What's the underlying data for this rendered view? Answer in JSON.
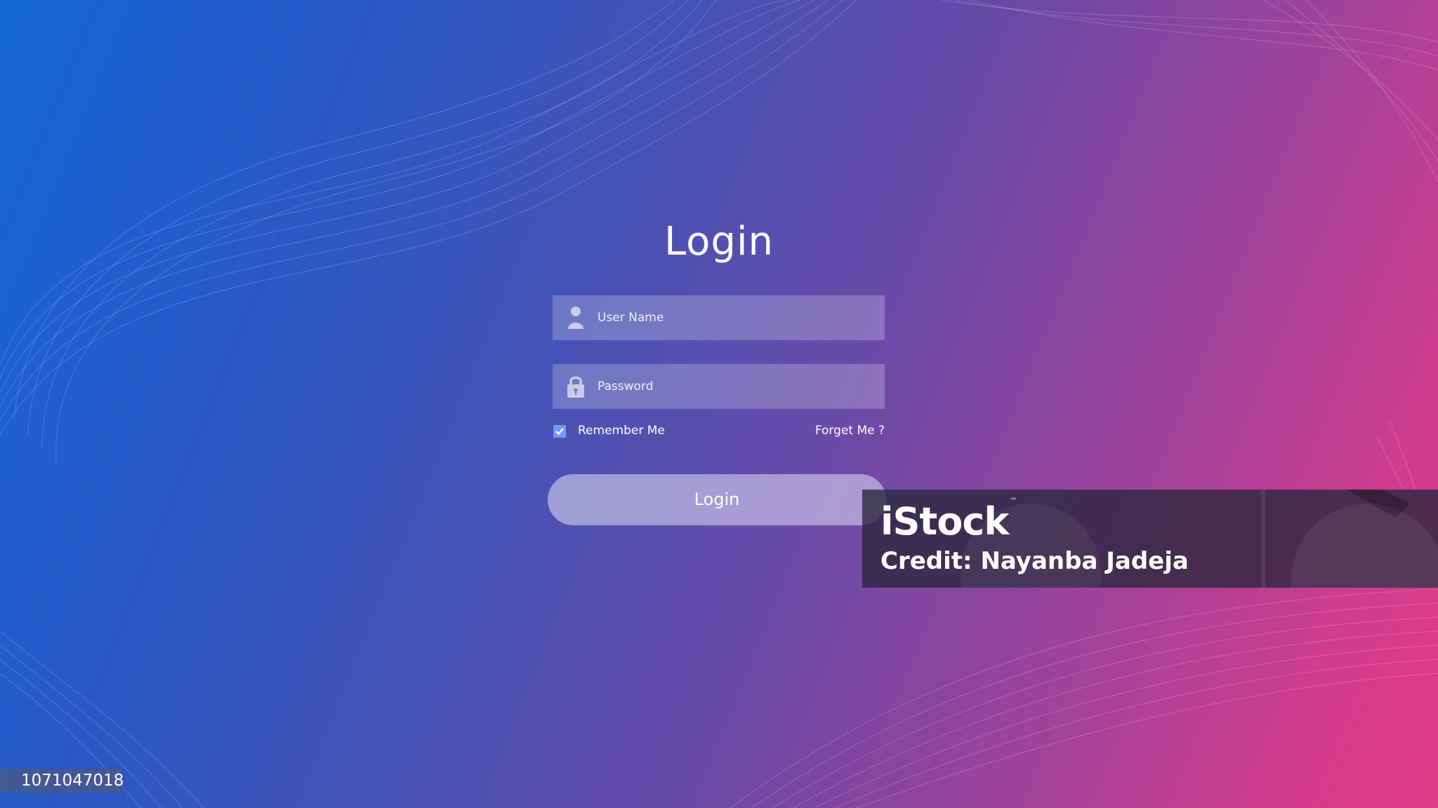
{
  "login": {
    "title": "Login",
    "username_placeholder": "User Name",
    "password_placeholder": "Password",
    "remember_label": "Remember Me",
    "remember_checked": true,
    "forget_label": "Forget Me ?",
    "button_label": "Login"
  },
  "icons": {
    "username": "user-icon",
    "password": "lock-icon",
    "remember": "check-icon"
  },
  "watermark": {
    "logo": "iStock",
    "trademark": "™",
    "credit": "Credit: Nayanba Jadeja"
  },
  "image_id": "1071047018",
  "colors": {
    "gradient_start": "#1566d6",
    "gradient_mid": "#6b4aa8",
    "gradient_end": "#e03a88",
    "checkbox": "#6e9ef6"
  }
}
